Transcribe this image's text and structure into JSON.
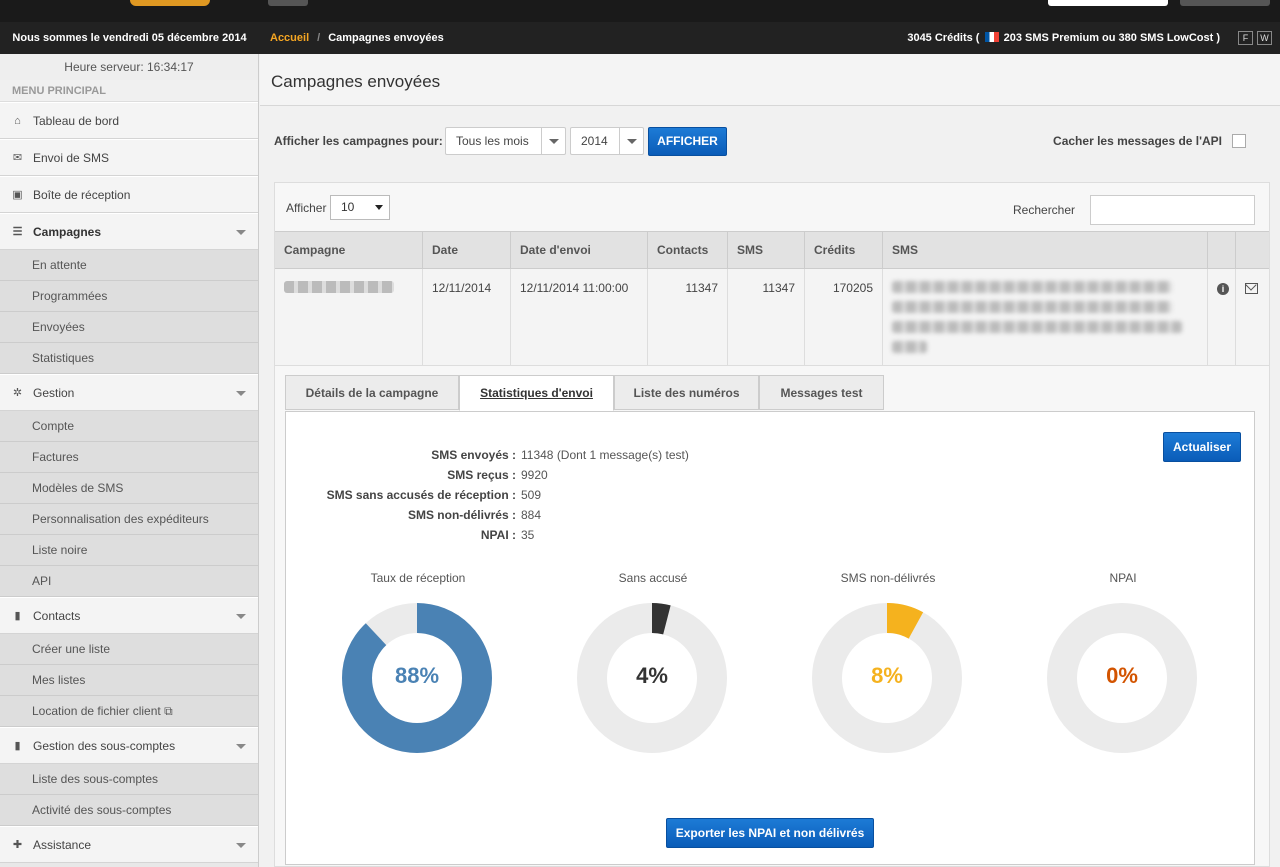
{
  "header": {
    "date_text": "Nous sommes le vendredi 05 décembre 2014",
    "breadcrumb_home": "Accueil",
    "breadcrumb_sep": "/",
    "breadcrumb_current": "Campagnes envoyées",
    "credits_prefix": "3045 Crédits (",
    "credits_suffix": "203 SMS Premium ou 380 SMS LowCost )",
    "lang_f": "F",
    "lang_w": "W"
  },
  "sidebar": {
    "server_time": "Heure serveur: 16:34:17",
    "menu_title": "MENU PRINCIPAL",
    "items": {
      "dashboard": "Tableau de bord",
      "send_sms": "Envoi de SMS",
      "inbox": "Boîte de réception",
      "campaigns": "Campagnes",
      "pending": "En attente",
      "scheduled": "Programmées",
      "sent": "Envoyées",
      "stats": "Statistiques",
      "management": "Gestion",
      "account": "Compte",
      "invoices": "Factures",
      "sms_templates": "Modèles de SMS",
      "senders": "Personnalisation des expéditeurs",
      "blacklist": "Liste noire",
      "api": "API",
      "contacts": "Contacts",
      "create_list": "Créer une liste",
      "my_lists": "Mes listes",
      "file_rental": "Location de fichier client",
      "subaccounts": "Gestion des sous-comptes",
      "subaccounts_list": "Liste des sous-comptes",
      "subaccounts_activity": "Activité des sous-comptes",
      "support": "Assistance"
    }
  },
  "main": {
    "title": "Campagnes envoyées",
    "filter_label": "Afficher les campagnes pour:",
    "month_select": "Tous les mois",
    "year_select": "2014",
    "show_button": "AFFICHER",
    "hide_api_label": "Cacher les messages de l'API",
    "table": {
      "show_label": "Afficher",
      "page_size": "10",
      "search_label": "Rechercher",
      "columns": [
        "Campagne",
        "Date",
        "Date d'envoi",
        "Contacts",
        "SMS",
        "Crédits",
        "SMS"
      ],
      "row": {
        "date": "12/11/2014",
        "send_date": "12/11/2014 11:00:00",
        "contacts": "11347",
        "sms": "11347",
        "credits": "170205"
      }
    },
    "tabs": [
      "Détails de la campagne",
      "Statistiques d'envoi",
      "Liste des numéros",
      "Messages test"
    ],
    "refresh_button": "Actualiser",
    "stats": [
      {
        "label": "SMS envoyés :",
        "value": "11348 (Dont 1 message(s) test)"
      },
      {
        "label": "SMS reçus :",
        "value": "9920"
      },
      {
        "label": "SMS sans accusés de réception :",
        "value": "509"
      },
      {
        "label": "SMS non-délivrés :",
        "value": "884"
      },
      {
        "label": "NPAI :",
        "value": "35"
      }
    ],
    "export_button": "Exporter les NPAI et non délivrés"
  },
  "chart_data": {
    "type": "pie",
    "donuts": [
      {
        "title": "Taux de réception",
        "value": 88,
        "label": "88%",
        "color": "#4a82b4"
      },
      {
        "title": "Sans accusé",
        "value": 4,
        "label": "4%",
        "color": "#333333"
      },
      {
        "title": "SMS non-délivrés",
        "value": 8,
        "label": "8%",
        "color": "#f5b21e"
      },
      {
        "title": "NPAI",
        "value": 0,
        "label": "0%",
        "color": "#d35400"
      }
    ],
    "track_color": "#ebebeb"
  }
}
